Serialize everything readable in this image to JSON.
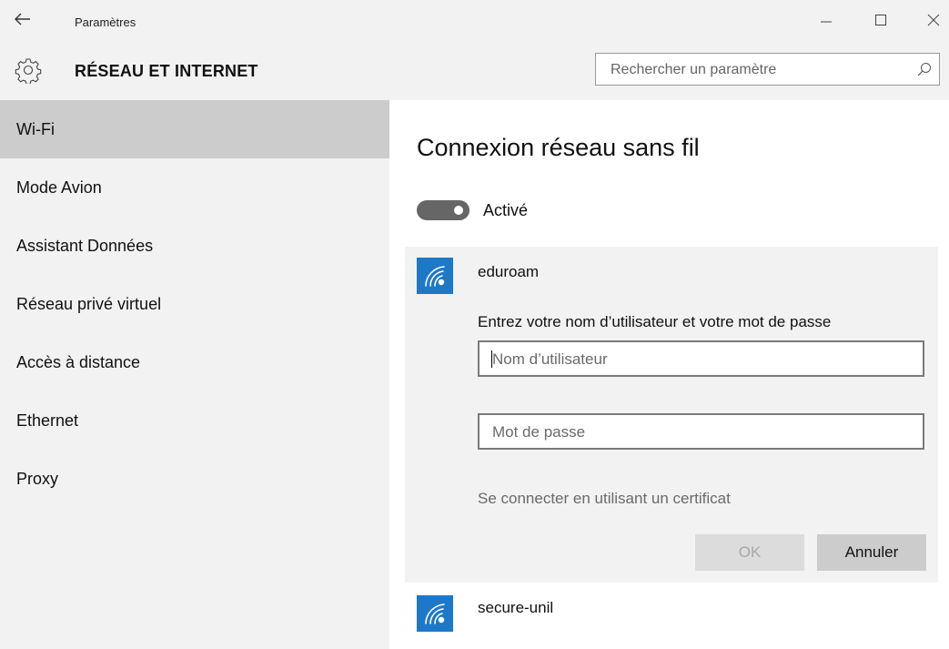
{
  "window": {
    "title": "Paramètres",
    "back_icon": "back-arrow-icon",
    "controls": [
      "minimize-icon",
      "maximize-icon",
      "close-icon"
    ]
  },
  "header": {
    "icon": "gear-icon",
    "title": "RÉSEAU ET INTERNET",
    "search": {
      "placeholder": "Rechercher un paramètre",
      "value": "",
      "icon": "search-icon"
    }
  },
  "sidebar": {
    "items": [
      {
        "label": "Wi-Fi",
        "selected": true
      },
      {
        "label": "Mode Avion",
        "selected": false
      },
      {
        "label": "Assistant Données",
        "selected": false
      },
      {
        "label": "Réseau privé virtuel",
        "selected": false
      },
      {
        "label": "Accès à distance",
        "selected": false
      },
      {
        "label": "Ethernet",
        "selected": false
      },
      {
        "label": "Proxy",
        "selected": false
      }
    ]
  },
  "main": {
    "title": "Connexion réseau sans fil",
    "toggle": {
      "state": "on",
      "label": "Activé"
    },
    "networks": [
      {
        "name": "eduroam",
        "icon": "wifi-icon",
        "expanded": true,
        "prompt": "Entrez votre nom d’utilisateur et votre mot de passe",
        "username": {
          "placeholder": "Nom d’utilisateur",
          "value": ""
        },
        "password": {
          "placeholder": "Mot de passe",
          "value": ""
        },
        "certificate_link": "Se connecter en utilisant un certificat",
        "ok_label": "OK",
        "cancel_label": "Annuler"
      },
      {
        "name": "secure-unil",
        "icon": "wifi-icon",
        "expanded": false
      }
    ]
  },
  "colors": {
    "accent": "#1e78c8",
    "chrome_bg": "#f2f2f2",
    "selected_nav": "#cccccc",
    "toggle_on": "#666666"
  }
}
